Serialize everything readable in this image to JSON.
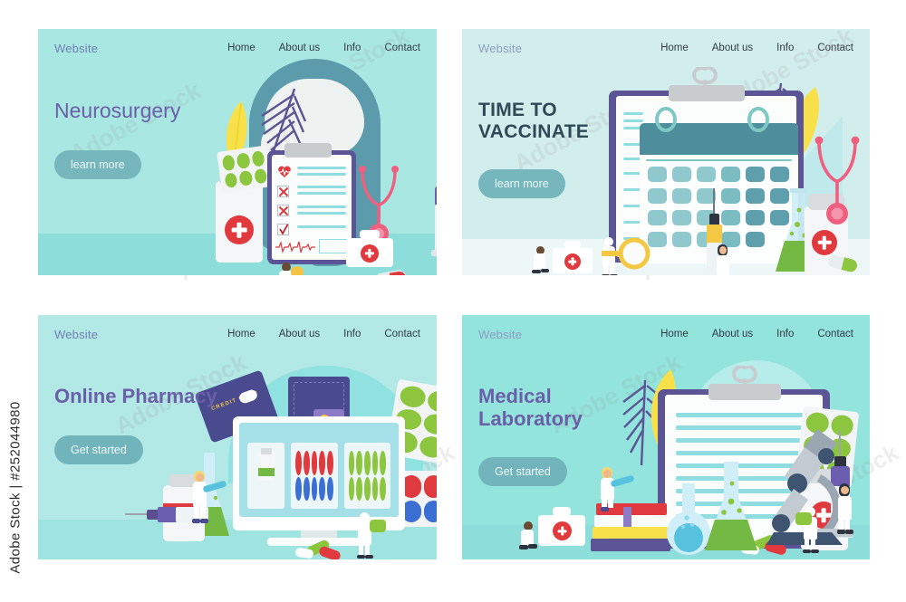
{
  "watermark": {
    "left_text": "Adobe Stock | #252044980",
    "tile_text": "Adobe Stock"
  },
  "nav": {
    "brand": "Website",
    "links": [
      "Home",
      "About  us",
      "Info",
      "Contact"
    ]
  },
  "colors": {
    "panel1_bg": "#a9e7e3",
    "panel2_bg": "#d2eeec",
    "panel3_bg": "#b2e8e6",
    "panel4_bg": "#93e4dd",
    "title_purple": "#6a5fa8",
    "title_dark_teal": "#2e4a57",
    "cta_teal": "#76b7bd",
    "brand_blue": "#6d7fb3",
    "accent_red": "#e03a3e",
    "accent_pink": "#ef5f80",
    "flask_green": "#74b943",
    "flask_blue": "#56c2dd",
    "pill_green": "#8cc63f",
    "yellow_leaf": "#f7e04a",
    "palm_purple": "#5b5596"
  },
  "panels": [
    {
      "id": "neurosurgery",
      "brand": "Website",
      "links": [
        "Home",
        "About  us",
        "Info",
        "Contact"
      ],
      "title": "Neurosurgery",
      "cta": "learn more",
      "art": "head-brain-clipboard-checklist-stethoscope-syringe-firstaidkit-pills"
    },
    {
      "id": "vaccinate",
      "brand": "Website",
      "links": [
        "Home",
        "About  us",
        "Info",
        "Contact"
      ],
      "title": "TIME TO VACCINATE",
      "cta": "learn more",
      "art": "calendar-clipboard-syringe-flask-stethoscope-magnifier-firstaidkit"
    },
    {
      "id": "pharmacy",
      "brand": "Website",
      "links": [
        "Home",
        "About  us",
        "Info",
        "Contact"
      ],
      "title": "Online Pharmacy",
      "cta": "Get started",
      "art": "monitor-creditcard-wallet-blisterpacks-flask-bottle-syringe"
    },
    {
      "id": "laboratory",
      "brand": "Website",
      "links": [
        "Home",
        "About  us",
        "Info",
        "Contact"
      ],
      "title": "Medical Laboratory",
      "cta": "Get started",
      "art": "clipboard-microscope-flasks-books-syringe-firstaidkit-blisterpack"
    }
  ],
  "art_labels": {
    "credit_card": "CREDIT CARD",
    "checklist_marks": [
      "heart",
      "x",
      "x",
      "check",
      "ecg"
    ],
    "monitor_products": [
      "medicine-bottle",
      "red-blue-capsules",
      "green-pills"
    ]
  }
}
